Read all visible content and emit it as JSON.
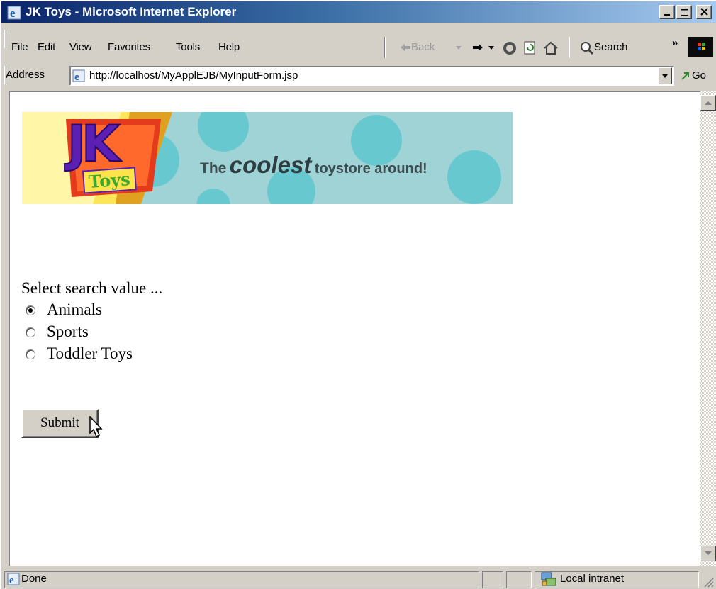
{
  "window": {
    "title": "JK Toys - Microsoft Internet Explorer"
  },
  "menu": {
    "items": [
      "File",
      "Edit",
      "View",
      "Favorites",
      "Tools",
      "Help"
    ]
  },
  "toolbar": {
    "back_label": "Back",
    "search_label": "Search",
    "chevron": "»"
  },
  "address": {
    "label": "Address",
    "url": "http://localhost/MyApplEJB/MyInputForm.jsp",
    "go_label": "Go"
  },
  "banner": {
    "logo_text_top": "JK",
    "logo_text_bottom": "Toys",
    "tagline_the": "The",
    "tagline_coolest": "coolest",
    "tagline_rest": "toystore around!"
  },
  "form": {
    "prompt": "Select search value ...",
    "options": [
      {
        "label": "Animals",
        "checked": true
      },
      {
        "label": "Sports",
        "checked": false
      },
      {
        "label": "Toddler Toys",
        "checked": false
      }
    ],
    "submit_label": "Submit"
  },
  "status": {
    "text": "Done",
    "zone": "Local intranet"
  },
  "colors": {
    "titlebar_start": "#0a246a",
    "titlebar_end": "#a6caf0",
    "chrome": "#d4d0c8",
    "banner_teal": "#9fd3d6",
    "logo_purple": "#5b1fb4",
    "logo_yellow": "#fde55a"
  },
  "icons": [
    "ie-logo-icon",
    "minimize-icon",
    "maximize-icon",
    "close-icon",
    "back-arrow-icon",
    "forward-arrow-icon",
    "stop-icon",
    "refresh-icon",
    "home-icon",
    "search-icon",
    "windows-flag-icon",
    "page-icon",
    "dropdown-arrow-icon",
    "go-arrow-icon",
    "scroll-up-icon",
    "scroll-down-icon",
    "cursor-icon",
    "intranet-icon",
    "resize-grip-icon"
  ]
}
